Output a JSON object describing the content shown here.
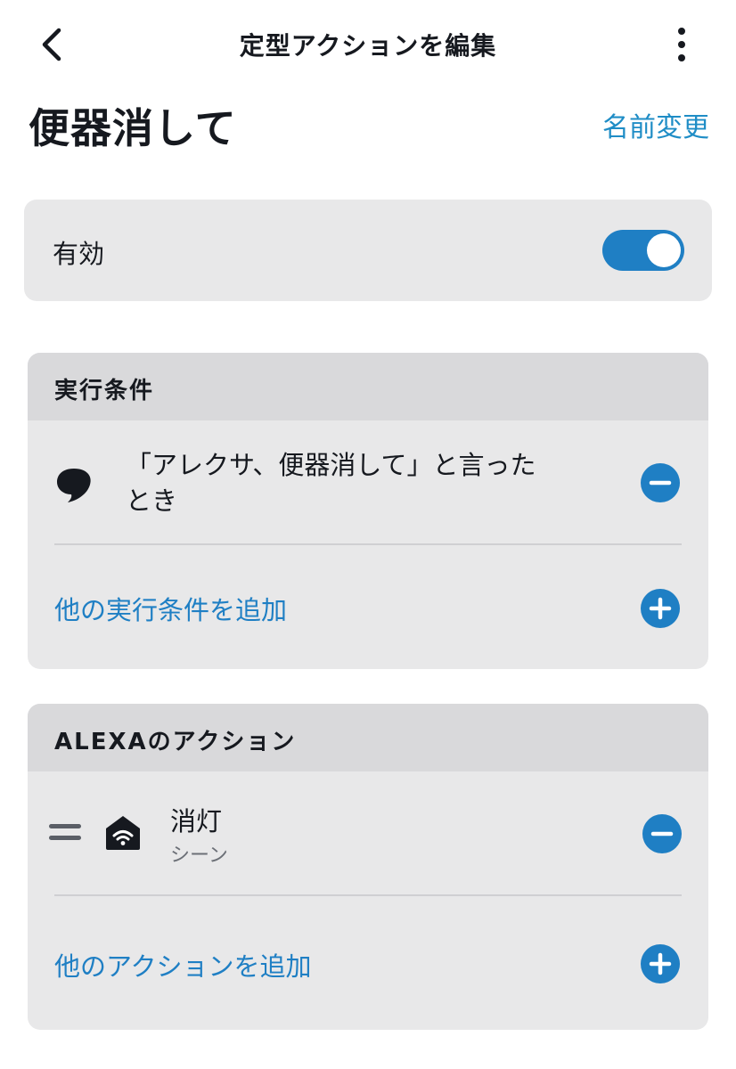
{
  "header": {
    "title": "定型アクションを編集",
    "back_icon": "chevron-left-icon",
    "more_icon": "more-vertical-icon"
  },
  "routine": {
    "name": "便器消して",
    "rename_label": "名前変更"
  },
  "enabled": {
    "label": "有効",
    "on": true
  },
  "triggers": {
    "header": "実行条件",
    "items": [
      {
        "icon": "speech-bubble-icon",
        "text_line1": "「アレクサ、便器消して」と言った",
        "text_line2": "とき"
      }
    ],
    "add_label": "他の実行条件を追加"
  },
  "actions": {
    "header": "ALEXAのアクション",
    "items": [
      {
        "icon": "smart-home-icon",
        "title": "消灯",
        "subtitle": "シーン"
      }
    ],
    "add_label": "他のアクションを追加"
  },
  "colors": {
    "accent": "#1f7fc4",
    "link": "#1f8dc6",
    "card_bg": "#e8e8e9",
    "card_header_bg": "#d9d9db",
    "text": "#16191f"
  }
}
